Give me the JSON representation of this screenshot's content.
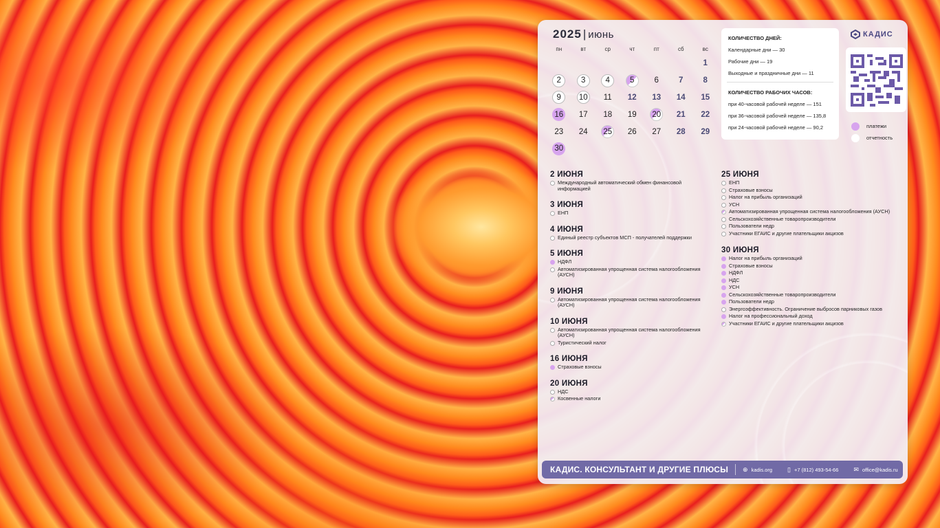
{
  "calendar": {
    "year": "2025",
    "separator": "|",
    "month": "июнь",
    "weekdays": [
      "пн",
      "вт",
      "ср",
      "чт",
      "пт",
      "сб",
      "вс"
    ],
    "days": [
      {
        "n": "",
        "t": ""
      },
      {
        "n": "",
        "t": ""
      },
      {
        "n": "",
        "t": ""
      },
      {
        "n": "",
        "t": ""
      },
      {
        "n": "",
        "t": ""
      },
      {
        "n": "",
        "t": ""
      },
      {
        "n": "1",
        "t": "we"
      },
      {
        "n": "2",
        "t": "rep"
      },
      {
        "n": "3",
        "t": "rep"
      },
      {
        "n": "4",
        "t": "rep"
      },
      {
        "n": "5",
        "t": "both"
      },
      {
        "n": "6",
        "t": ""
      },
      {
        "n": "7",
        "t": "we"
      },
      {
        "n": "8",
        "t": "we"
      },
      {
        "n": "9",
        "t": "rep"
      },
      {
        "n": "10",
        "t": "rep"
      },
      {
        "n": "11",
        "t": ""
      },
      {
        "n": "12",
        "t": "we"
      },
      {
        "n": "13",
        "t": "we"
      },
      {
        "n": "14",
        "t": "we"
      },
      {
        "n": "15",
        "t": "we"
      },
      {
        "n": "16",
        "t": "pay"
      },
      {
        "n": "17",
        "t": ""
      },
      {
        "n": "18",
        "t": ""
      },
      {
        "n": "19",
        "t": ""
      },
      {
        "n": "20",
        "t": "both"
      },
      {
        "n": "21",
        "t": "we"
      },
      {
        "n": "22",
        "t": "we"
      },
      {
        "n": "23",
        "t": ""
      },
      {
        "n": "24",
        "t": ""
      },
      {
        "n": "25",
        "t": "both"
      },
      {
        "n": "26",
        "t": ""
      },
      {
        "n": "27",
        "t": ""
      },
      {
        "n": "28",
        "t": "we"
      },
      {
        "n": "29",
        "t": "we"
      },
      {
        "n": "30",
        "t": "pay"
      }
    ]
  },
  "info": {
    "days_title": "КОЛИЧЕСТВО ДНЕЙ:",
    "calendar_days": "Календарные дни — 30",
    "working_days": "Рабочие дни — 19",
    "weekend_days": "Выходные и праздничные дни — 11",
    "hours_title": "КОЛИЧЕСТВО РАБОЧИХ ЧАСОВ:",
    "h40": "при 40-часовой рабочей неделе — 151",
    "h36": "при 36-часовой рабочей неделе — 135,8",
    "h24": "при 24-часовой рабочей неделе — 90,2"
  },
  "brand": {
    "logo": "КАДИС"
  },
  "legend": {
    "payments": "платежи",
    "reports": "отчетность"
  },
  "events_left": [
    {
      "title": "2 ИЮНЯ",
      "items": [
        {
          "k": "rep",
          "t": "Международный автоматический обмен финансовой информацией"
        }
      ]
    },
    {
      "title": "3 ИЮНЯ",
      "items": [
        {
          "k": "rep",
          "t": "ЕНП"
        }
      ]
    },
    {
      "title": "4 ИЮНЯ",
      "items": [
        {
          "k": "rep",
          "t": "Единый реестр субъектов МСП - получателей поддержки"
        }
      ]
    },
    {
      "title": "5 ИЮНЯ",
      "items": [
        {
          "k": "pay",
          "t": "НДФЛ"
        },
        {
          "k": "rep",
          "t": "Автоматизированная упрощенная система налогообложения (АУСН)"
        }
      ]
    },
    {
      "title": "9 ИЮНЯ",
      "items": [
        {
          "k": "rep",
          "t": "Автоматизированная упрощенная система налогообложения (АУСН)"
        }
      ]
    },
    {
      "title": "10 ИЮНЯ",
      "items": [
        {
          "k": "rep",
          "t": "Автоматизированная упрощенная система налогообложения (АУСН)"
        },
        {
          "k": "rep",
          "t": "Туристический налог"
        }
      ]
    },
    {
      "title": "16 ИЮНЯ",
      "items": [
        {
          "k": "pay",
          "t": "Страховые взносы"
        }
      ]
    },
    {
      "title": "20 ИЮНЯ",
      "items": [
        {
          "k": "rep",
          "t": "НДС"
        },
        {
          "k": "both",
          "t": "Косвенные налоги"
        }
      ]
    }
  ],
  "events_right": [
    {
      "title": "25 ИЮНЯ",
      "items": [
        {
          "k": "rep",
          "t": "ЕНП"
        },
        {
          "k": "rep",
          "t": "Страховые взносы"
        },
        {
          "k": "rep",
          "t": "Налог на прибыль организаций"
        },
        {
          "k": "rep",
          "t": "УСН"
        },
        {
          "k": "both",
          "t": "Автоматизированная упрощенная система налогообложения (АУСН)"
        },
        {
          "k": "rep",
          "t": "Сельскохозяйственные товаропроизводители"
        },
        {
          "k": "rep",
          "t": "Пользователи недр"
        },
        {
          "k": "rep",
          "t": "Участники ЕГАИС и другие плательщики акцизов"
        }
      ]
    },
    {
      "title": "30 ИЮНЯ",
      "items": [
        {
          "k": "pay",
          "t": "Налог на прибыль организаций"
        },
        {
          "k": "pay",
          "t": "Страховые взносы"
        },
        {
          "k": "pay",
          "t": "НДФЛ"
        },
        {
          "k": "pay",
          "t": "НДС"
        },
        {
          "k": "pay",
          "t": "УСН"
        },
        {
          "k": "pay",
          "t": "Сельскохозяйственные товаропроизводители"
        },
        {
          "k": "pay",
          "t": "Пользователи недр"
        },
        {
          "k": "rep",
          "t": "Энергоэффективность. Ограничение выбросов парниковых газов"
        },
        {
          "k": "pay",
          "t": "Налог на профессиональный доход"
        },
        {
          "k": "both",
          "t": "Участники ЕГАИС и другие плательщики акцизов"
        }
      ]
    }
  ],
  "footer": {
    "brand": "КАДИС. КОНСУЛЬТАНТ И ДРУГИЕ ПЛЮСЫ",
    "site": "kadis.org",
    "phone": "+7 (812) 493-54-66",
    "email": "office@kadis.ru"
  },
  "colors": {
    "payments": "#d7a4ee",
    "reports": "#ffffff",
    "accent": "#716aa6"
  }
}
